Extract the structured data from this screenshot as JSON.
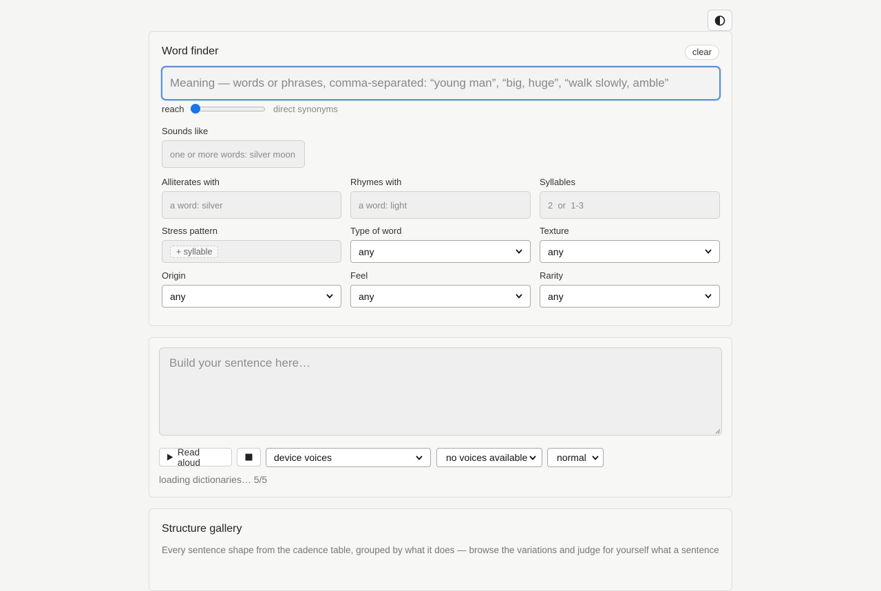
{
  "header": {
    "theme_toggle_icon": "contrast-icon"
  },
  "finder": {
    "title": "Word finder",
    "clear_label": "clear",
    "meaning_placeholder": "Meaning — words or phrases, comma-separated: “young man”, “big, huge”, “walk slowly, amble”",
    "reach": {
      "label": "reach",
      "value": 0,
      "hint": "direct synonyms"
    },
    "sounds_like": {
      "label": "Sounds like",
      "placeholder": "one or more words: silver moon"
    },
    "alliterates": {
      "label": "Alliterates with",
      "placeholder": "a word: silver"
    },
    "rhymes": {
      "label": "Rhymes with",
      "placeholder": "a word: light"
    },
    "syllables": {
      "label": "Syllables",
      "placeholder": "2  or  1-3"
    },
    "stress": {
      "label": "Stress pattern",
      "chip": "+ syllable"
    },
    "type_of_word": {
      "label": "Type of word",
      "value": "any"
    },
    "texture": {
      "label": "Texture",
      "value": "any"
    },
    "origin": {
      "label": "Origin",
      "value": "any"
    },
    "feel": {
      "label": "Feel",
      "value": "any"
    },
    "rarity": {
      "label": "Rarity",
      "value": "any"
    }
  },
  "composer": {
    "placeholder": "Build your sentence here…",
    "read_aloud": "Read aloud",
    "voice_source": "device voices",
    "voice": "no voices available",
    "speed": "normal",
    "status": "loading dictionaries… 5/5"
  },
  "gallery": {
    "title": "Structure gallery",
    "description": "Every sentence shape from the cadence table, grouped by what it does — browse the variations and judge for yourself what a sentence"
  },
  "colors": {
    "accent": "#1a73e8",
    "focus_border": "#5b8fd6",
    "background": "#f5f5f4"
  }
}
